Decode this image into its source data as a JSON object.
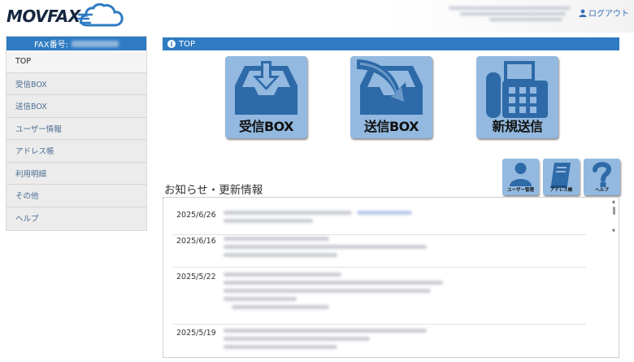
{
  "header": {
    "brand": "MOVFAX",
    "logout_label": "ログアウト"
  },
  "sidebar": {
    "fax_label": "FAX番号:",
    "items": [
      {
        "label": "TOP",
        "active": true
      },
      {
        "label": "受信BOX"
      },
      {
        "label": "送信BOX"
      },
      {
        "label": "ユーザー情報"
      },
      {
        "label": "アドレス帳"
      },
      {
        "label": "利用明細"
      },
      {
        "label": "その他"
      },
      {
        "label": "ヘルプ"
      }
    ]
  },
  "main": {
    "title": "TOP",
    "tiles": [
      {
        "label": "受信BOX",
        "icon": "inbox-download-icon"
      },
      {
        "label": "送信BOX",
        "icon": "outbox-send-icon"
      },
      {
        "label": "新規送信",
        "icon": "fax-machine-icon"
      }
    ],
    "small_tiles": [
      {
        "label": "ユーザー管理",
        "icon": "user-icon"
      },
      {
        "label": "アドレス帳",
        "icon": "book-icon"
      },
      {
        "label": "ヘルプ",
        "icon": "question-icon"
      }
    ],
    "news_title": "お知らせ・更新情報",
    "news": [
      {
        "date": "2025/6/26"
      },
      {
        "date": "2025/6/16"
      },
      {
        "date": "2025/5/22"
      },
      {
        "date": "2025/5/19"
      }
    ]
  },
  "colors": {
    "accent": "#2f7bc2",
    "tile": "#93b9e0",
    "icon": "#2e6aa8"
  }
}
